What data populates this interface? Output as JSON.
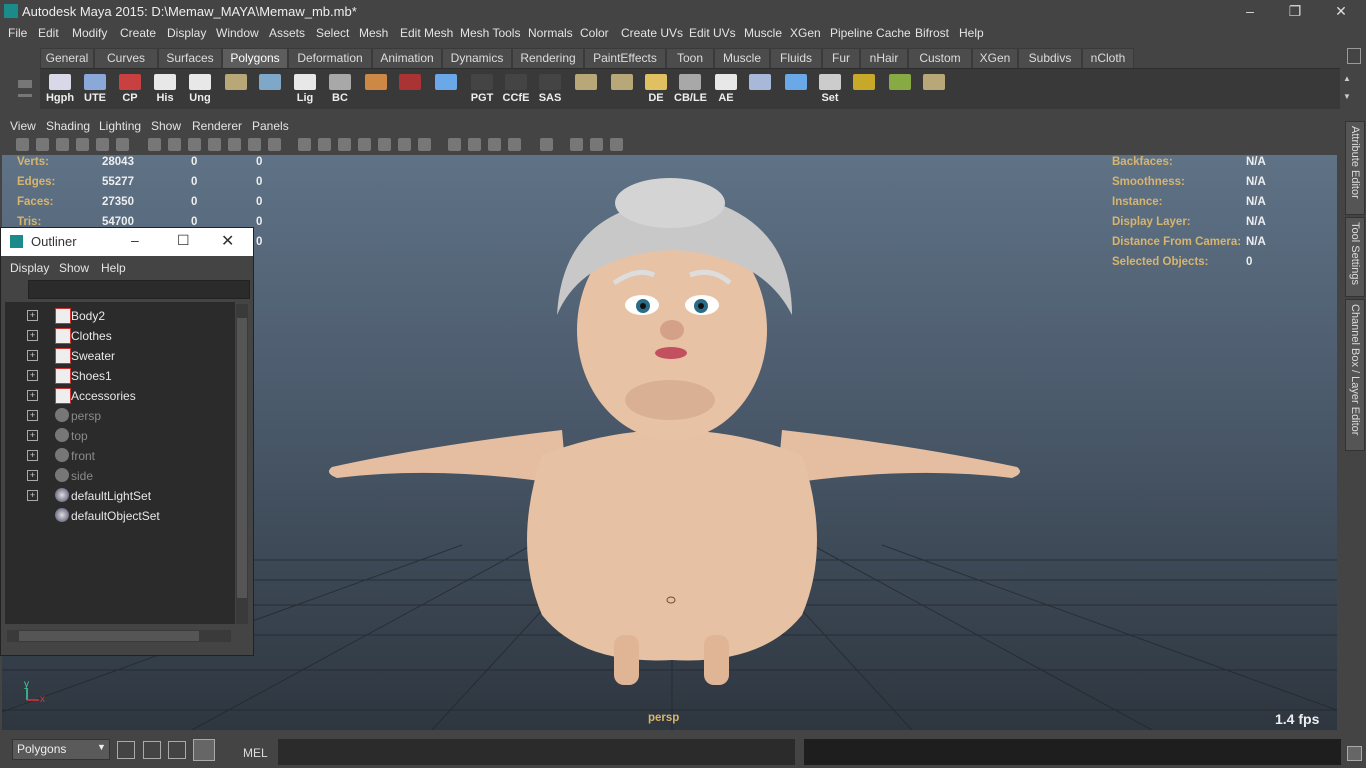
{
  "window": {
    "title": "Autodesk Maya 2015: D:\\Memaw_MAYA\\Memaw_mb.mb*"
  },
  "menubar": [
    "File",
    "Edit",
    "Modify",
    "Create",
    "Display",
    "Window",
    "Assets",
    "Select",
    "Mesh",
    "Edit Mesh",
    "Mesh Tools",
    "Normals",
    "Color",
    "Create UVs",
    "Edit UVs",
    "Muscle",
    "XGen",
    "Pipeline Cache",
    "Bifrost",
    "Help"
  ],
  "shelf_tabs": [
    "General",
    "Curves",
    "Surfaces",
    "Polygons",
    "Deformation",
    "Animation",
    "Dynamics",
    "Rendering",
    "PaintEffects",
    "Toon",
    "Muscle",
    "Fluids",
    "Fur",
    "nHair",
    "Custom",
    "XGen",
    "Subdivs",
    "nCloth"
  ],
  "shelf_active_tab": "Polygons",
  "shelf_icons": [
    {
      "label": "Hgph",
      "icon": "hypergraph-icon"
    },
    {
      "label": "UTE",
      "icon": "uv-editor-icon"
    },
    {
      "label": "CP",
      "icon": "center-pivot-icon"
    },
    {
      "label": "His",
      "icon": "delete-history-icon"
    },
    {
      "label": "Ung",
      "icon": "ungroup-icon"
    },
    {
      "label": "",
      "icon": "bandage-icon"
    },
    {
      "label": "",
      "icon": "globe-select-icon"
    },
    {
      "label": "Lig",
      "icon": "light-editor-icon"
    },
    {
      "label": "BC",
      "icon": "eye-icon"
    },
    {
      "label": "",
      "icon": "manipulator-icon"
    },
    {
      "label": "",
      "icon": "gear-red-icon"
    },
    {
      "label": "",
      "icon": "curve-icon"
    },
    {
      "label": "PGT",
      "icon": "pgt-icon"
    },
    {
      "label": "CCfE",
      "icon": "ccfe-icon"
    },
    {
      "label": "SAS",
      "icon": "sas-icon"
    },
    {
      "label": "",
      "icon": "plane-icon"
    },
    {
      "label": "",
      "icon": "tiles-icon"
    },
    {
      "label": "DE",
      "icon": "display-layer-icon"
    },
    {
      "label": "CB/LE",
      "icon": "channel-box-icon"
    },
    {
      "label": "AE",
      "icon": "attribute-editor-icon"
    },
    {
      "label": "",
      "icon": "feather-icon"
    },
    {
      "label": "",
      "icon": "curve-blue-icon"
    },
    {
      "label": "Set",
      "icon": "set-key-icon"
    },
    {
      "label": "",
      "icon": "target-icon"
    },
    {
      "label": "",
      "icon": "sphere-target-icon"
    },
    {
      "label": "",
      "icon": "layers-icon"
    }
  ],
  "panel_menu": [
    "View",
    "Shading",
    "Lighting",
    "Show",
    "Renderer",
    "Panels"
  ],
  "hud_left": [
    {
      "label": "Verts:",
      "v1": "28043",
      "v2": "0",
      "v3": "0"
    },
    {
      "label": "Edges:",
      "v1": "55277",
      "v2": "0",
      "v3": "0"
    },
    {
      "label": "Faces:",
      "v1": "27350",
      "v2": "0",
      "v3": "0"
    },
    {
      "label": "Tris:",
      "v1": "54700",
      "v2": "0",
      "v3": "0"
    },
    {
      "label": "",
      "v1": "",
      "v2": "",
      "v3": "0"
    }
  ],
  "hud_right": [
    {
      "label": "Backfaces:",
      "value": "N/A"
    },
    {
      "label": "Smoothness:",
      "value": "N/A"
    },
    {
      "label": "Instance:",
      "value": "N/A"
    },
    {
      "label": "Display Layer:",
      "value": "N/A"
    },
    {
      "label": "Distance From Camera:",
      "value": "N/A"
    },
    {
      "label": "Selected Objects:",
      "value": "0"
    }
  ],
  "viewport": {
    "camera": "persp",
    "fps": "1.4 fps",
    "axis_y": "y",
    "axis_x": "x"
  },
  "outliner": {
    "title": "Outliner",
    "menu": [
      "Display",
      "Show",
      "Help"
    ],
    "items": [
      {
        "name": "Body2",
        "type": "mesh",
        "expand": true,
        "dim": false
      },
      {
        "name": "Clothes",
        "type": "mesh",
        "expand": true,
        "dim": false
      },
      {
        "name": "Sweater",
        "type": "mesh",
        "expand": true,
        "dim": false
      },
      {
        "name": "Shoes1",
        "type": "mesh",
        "expand": true,
        "dim": false
      },
      {
        "name": "Accessories",
        "type": "mesh",
        "expand": true,
        "dim": false
      },
      {
        "name": "persp",
        "type": "camera",
        "expand": true,
        "dim": true
      },
      {
        "name": "top",
        "type": "camera",
        "expand": true,
        "dim": true
      },
      {
        "name": "front",
        "type": "camera",
        "expand": true,
        "dim": true
      },
      {
        "name": "side",
        "type": "camera",
        "expand": true,
        "dim": true
      },
      {
        "name": "defaultLightSet",
        "type": "set",
        "expand": true,
        "dim": false
      },
      {
        "name": "defaultObjectSet",
        "type": "set",
        "expand": false,
        "dim": false
      }
    ]
  },
  "side_tabs": [
    "Attribute Editor",
    "Tool Settings",
    "Channel Box / Layer Editor"
  ],
  "command_line": {
    "mode": "Polygons",
    "lang": "MEL"
  },
  "colors": {
    "hud_label": "#d7b56e",
    "panel": "#444444",
    "viewport_top": "#5f7286",
    "viewport_bottom": "#2e363f",
    "skin": "#e7c1a3"
  }
}
